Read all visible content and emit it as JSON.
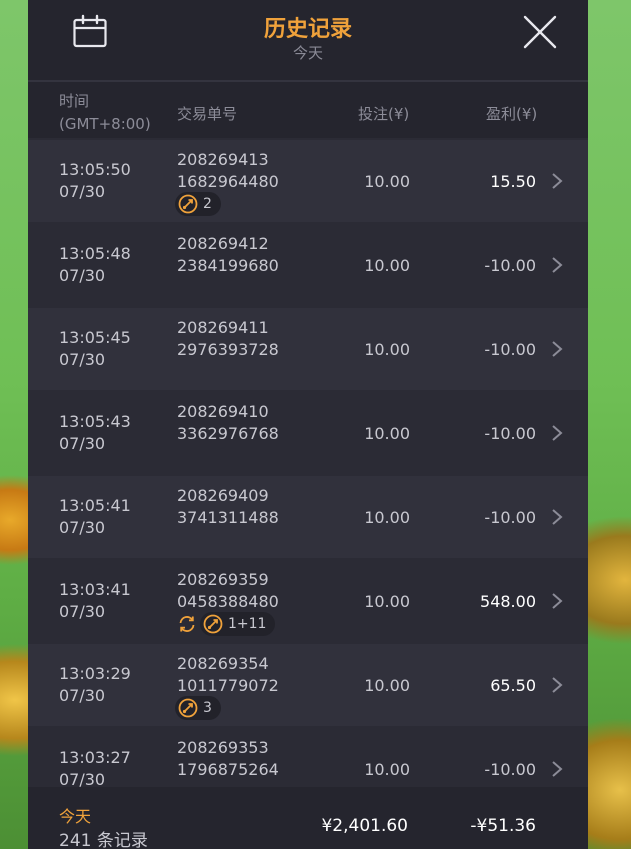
{
  "header": {
    "title": "历史记录",
    "subtitle": "今天",
    "calendar_icon": "calendar-icon",
    "close_icon": "close-icon"
  },
  "columns": {
    "time": "时间",
    "timezone": "(GMT+8:00)",
    "id": "交易单号",
    "bet": "投注(¥)",
    "profit": "盈利(¥)"
  },
  "rows": [
    {
      "time": "13:05:50",
      "date": "07/30",
      "id1": "208269413",
      "id2": "1682964480",
      "bet": "10.00",
      "profit": "15.50",
      "positive": true,
      "badge": "2",
      "spin": false
    },
    {
      "time": "13:05:48",
      "date": "07/30",
      "id1": "208269412",
      "id2": "2384199680",
      "bet": "10.00",
      "profit": "-10.00",
      "positive": false
    },
    {
      "time": "13:05:45",
      "date": "07/30",
      "id1": "208269411",
      "id2": "2976393728",
      "bet": "10.00",
      "profit": "-10.00",
      "positive": false
    },
    {
      "time": "13:05:43",
      "date": "07/30",
      "id1": "208269410",
      "id2": "3362976768",
      "bet": "10.00",
      "profit": "-10.00",
      "positive": false
    },
    {
      "time": "13:05:41",
      "date": "07/30",
      "id1": "208269409",
      "id2": "3741311488",
      "bet": "10.00",
      "profit": "-10.00",
      "positive": false
    },
    {
      "time": "13:03:41",
      "date": "07/30",
      "id1": "208269359",
      "id2": "0458388480",
      "bet": "10.00",
      "profit": "548.00",
      "positive": true,
      "badge": "1+11",
      "spin": true
    },
    {
      "time": "13:03:29",
      "date": "07/30",
      "id1": "208269354",
      "id2": "1011779072",
      "bet": "10.00",
      "profit": "65.50",
      "positive": true,
      "badge": "3",
      "spin": false
    },
    {
      "time": "13:03:27",
      "date": "07/30",
      "id1": "208269353",
      "id2": "1796875264",
      "bet": "10.00",
      "profit": "-10.00",
      "positive": false
    }
  ],
  "footer": {
    "label": "今天",
    "count": "241 条记录",
    "total_bet": "¥2,401.60",
    "total_profit": "-¥51.36"
  },
  "colors": {
    "accent": "#f0a23b",
    "panel": "#2b2b35",
    "row_alt": "#31313c"
  }
}
